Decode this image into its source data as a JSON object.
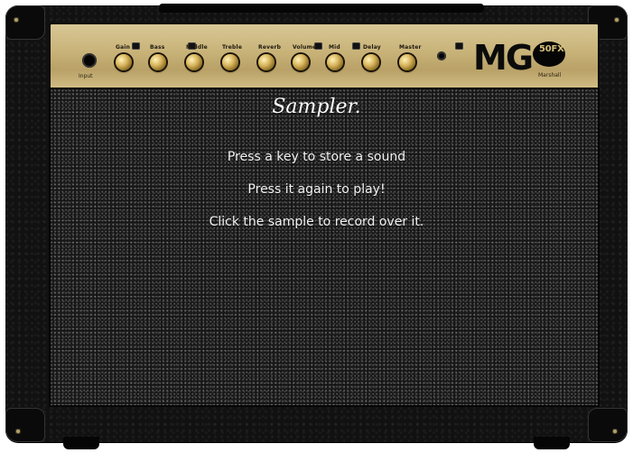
{
  "amp": {
    "panel": {
      "input_label": "Input",
      "knobs": [
        "Gain",
        "Bass",
        "Middle",
        "Treble",
        "Reverb",
        "Volume",
        "Mid",
        "Delay",
        "Master"
      ],
      "logo": "MG",
      "badge": "50FX",
      "sub": "Marshall"
    }
  },
  "sampler": {
    "title": "Sampler.",
    "lines": [
      "Press a key to store a sound",
      "Press it again to play!",
      "Click the sample to record over it."
    ]
  }
}
